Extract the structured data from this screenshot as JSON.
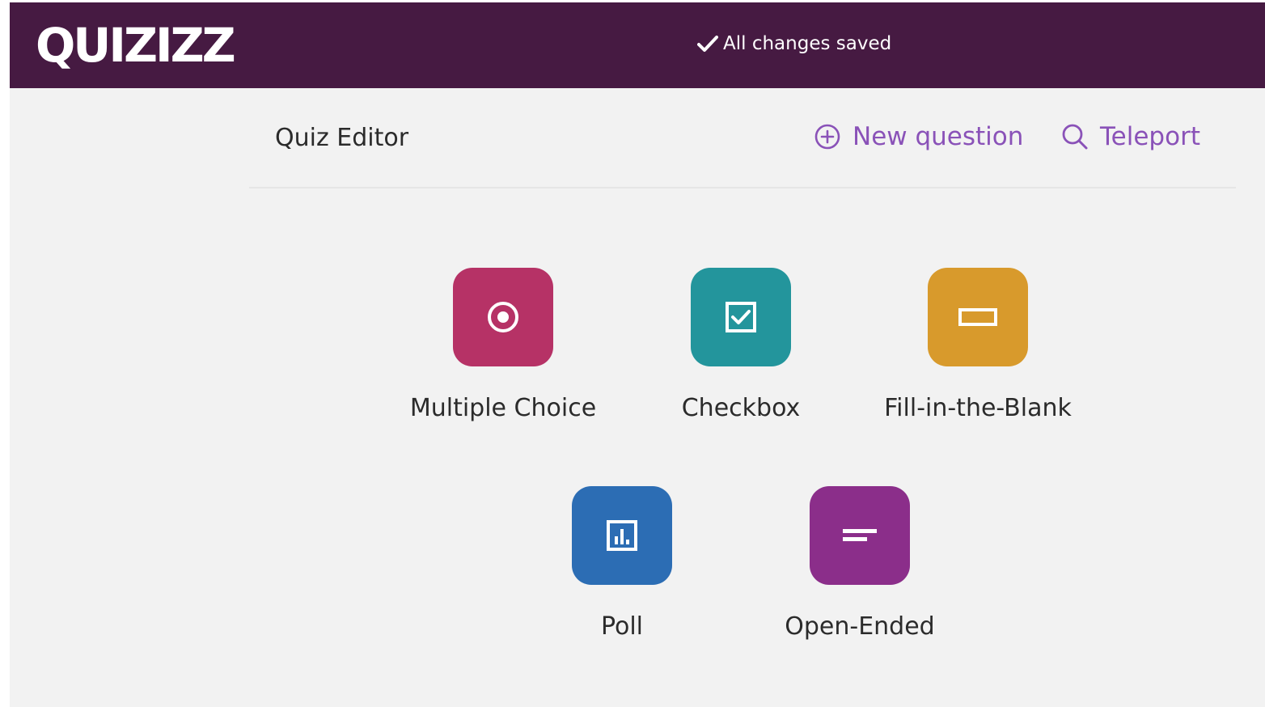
{
  "app": {
    "logo_text": "QUIZIZZ",
    "save_status": "All changes saved"
  },
  "editor": {
    "title": "Quiz Editor",
    "new_question_label": "New question",
    "teleport_label": "Teleport"
  },
  "question_types": [
    {
      "label": "Multiple Choice",
      "icon": "radio-target-icon",
      "color": "#b63266"
    },
    {
      "label": "Checkbox",
      "icon": "checkbox-checked-icon",
      "color": "#23959c"
    },
    {
      "label": "Fill-in-the-Blank",
      "icon": "blank-input-icon",
      "color": "#d89a2c"
    },
    {
      "label": "Poll",
      "icon": "bar-chart-icon",
      "color": "#2c6db4"
    },
    {
      "label": "Open-Ended",
      "icon": "text-lines-icon",
      "color": "#8b2e8a"
    }
  ],
  "colors": {
    "topbar": "#461a42",
    "accent": "#8a52b8",
    "background": "#f2f2f2"
  }
}
